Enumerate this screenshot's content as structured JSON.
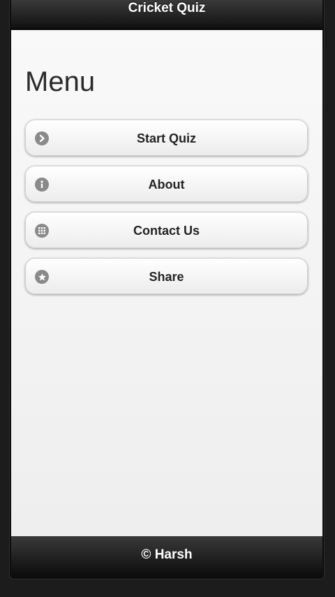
{
  "header": {
    "title": "Cricket Quiz"
  },
  "page": {
    "title": "Menu"
  },
  "menu": {
    "items": [
      {
        "label": "Start Quiz",
        "icon": "arrow-right-icon"
      },
      {
        "label": "About",
        "icon": "info-icon"
      },
      {
        "label": "Contact Us",
        "icon": "grid-icon"
      },
      {
        "label": "Share",
        "icon": "star-icon"
      }
    ]
  },
  "footer": {
    "text": "© Harsh"
  },
  "colors": {
    "header_bg": "#1a1a1a",
    "content_bg": "#f4f4f4",
    "icon_bg": "#8a8a8a",
    "text": "#222222"
  }
}
